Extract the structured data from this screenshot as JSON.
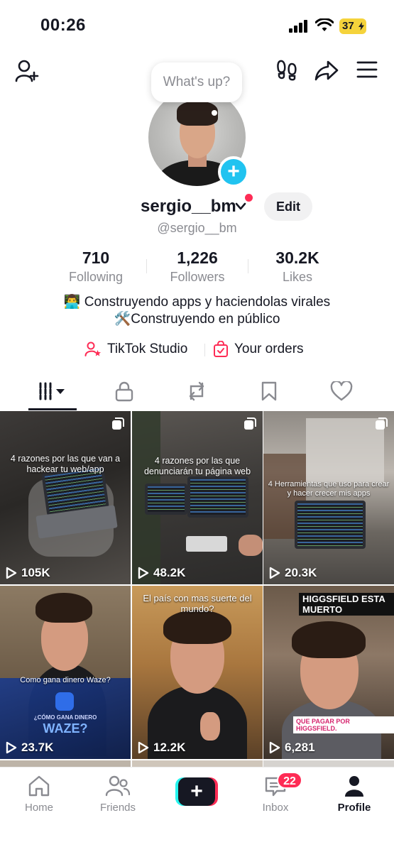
{
  "status_bar": {
    "time": "00:26",
    "battery": "37"
  },
  "profile": {
    "bubble_text": "What's up?",
    "display_name": "sergio__bm",
    "handle": "@sergio__bm",
    "edit_label": "Edit"
  },
  "stats": [
    {
      "value": "710",
      "label": "Following"
    },
    {
      "value": "1,226",
      "label": "Followers"
    },
    {
      "value": "30.2K",
      "label": "Likes"
    }
  ],
  "bio": {
    "line1": "👨‍💻 Construyendo apps y haciendolas virales",
    "line2": "🛠️Construyendo en público"
  },
  "links": {
    "studio": "TikTok Studio",
    "orders": "Your orders"
  },
  "tabs": [
    "videos-grid-icon",
    "lock-icon",
    "repost-icon",
    "bookmark-icon",
    "heart-icon"
  ],
  "videos": [
    {
      "overlay": "4 razones por las que van a hackear tu web/app",
      "views": "105K"
    },
    {
      "overlay": "4 razones por las que denunciarán tu página web",
      "views": "48.2K"
    },
    {
      "overlay": "4 Herramientas que uso para crear y hacer crecer mis apps",
      "views": "20.3K"
    },
    {
      "overlay": "Como gana dinero Waze?",
      "views": "23.7K",
      "screen_title": "¿CÓMO GANA DINERO",
      "screen_big": "WAZE?"
    },
    {
      "overlay": "El país con mas suerte del mundo?",
      "views": "12.2K"
    },
    {
      "overlay": "HIGGSFIELD ESTA MUERTO",
      "views": "6,281",
      "caption": "QUE PAGAR POR HIGGSFIELD."
    }
  ],
  "nav": {
    "home": "Home",
    "friends": "Friends",
    "inbox": "Inbox",
    "inbox_badge": "22",
    "profile": "Profile"
  },
  "colors": {
    "accent": "#fe2c55",
    "cyan": "#21c3f0",
    "battery": "#f5d33b"
  }
}
